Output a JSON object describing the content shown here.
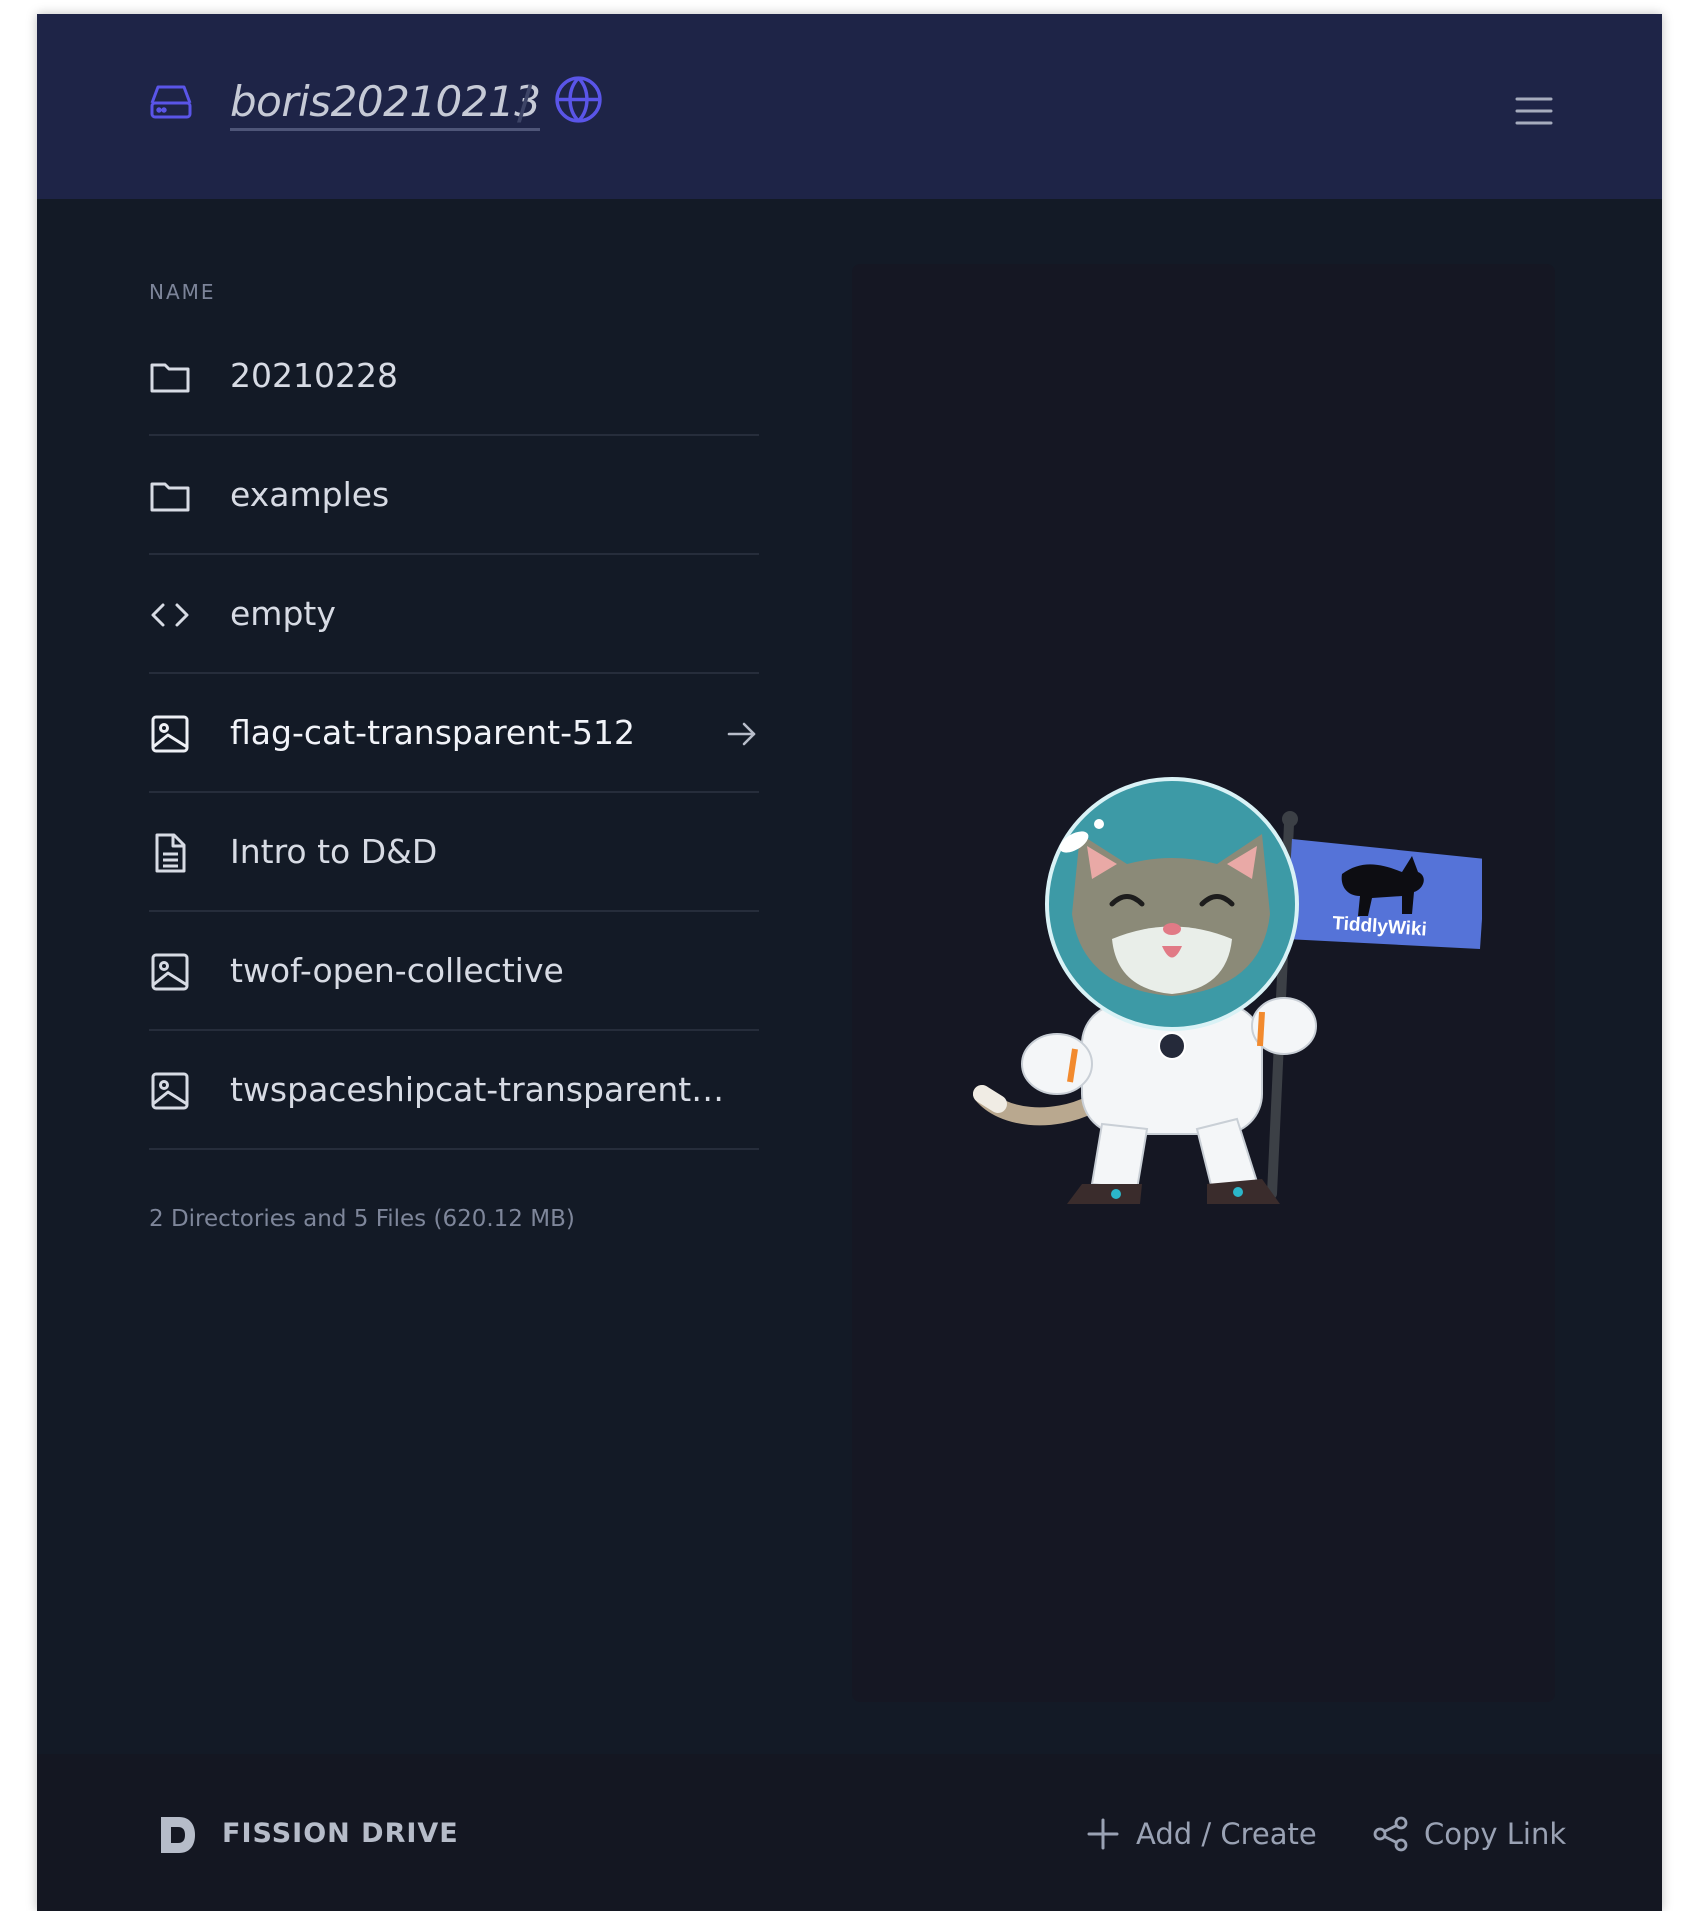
{
  "header": {
    "drive_name": "boris20210213",
    "separator": "/",
    "icons": {
      "drive": "hard-drive-icon",
      "public": "globe-icon",
      "menu": "hamburger-menu-icon"
    }
  },
  "file_list": {
    "column_header": "NAME",
    "items": [
      {
        "name": "20210228",
        "type": "directory",
        "icon": "folder-icon"
      },
      {
        "name": "examples",
        "type": "directory",
        "icon": "folder-icon"
      },
      {
        "name": "empty",
        "type": "code",
        "icon": "code-icon"
      },
      {
        "name": "flag-cat-transparent-512",
        "type": "image",
        "icon": "image-icon",
        "selected": true
      },
      {
        "name": "Intro to D&D",
        "type": "document",
        "icon": "document-icon"
      },
      {
        "name": "twof-open-collective",
        "type": "image",
        "icon": "image-icon"
      },
      {
        "name": "twspaceshipcat-transparent…",
        "type": "image",
        "icon": "image-icon"
      }
    ],
    "summary": "2 Directories and 5 Files (620.12 MB)"
  },
  "preview": {
    "image_subject": "astronaut cat holding a flag",
    "flag_text": "TiddlyWiki"
  },
  "footer": {
    "brand": "FISSION DRIVE",
    "add_label": "Add / Create",
    "copy_label": "Copy Link"
  },
  "colors": {
    "background": "#131a26",
    "header": "#1e2447",
    "accent": "#5a55e8",
    "text": "#d7dbe4",
    "muted": "#7e869a"
  }
}
